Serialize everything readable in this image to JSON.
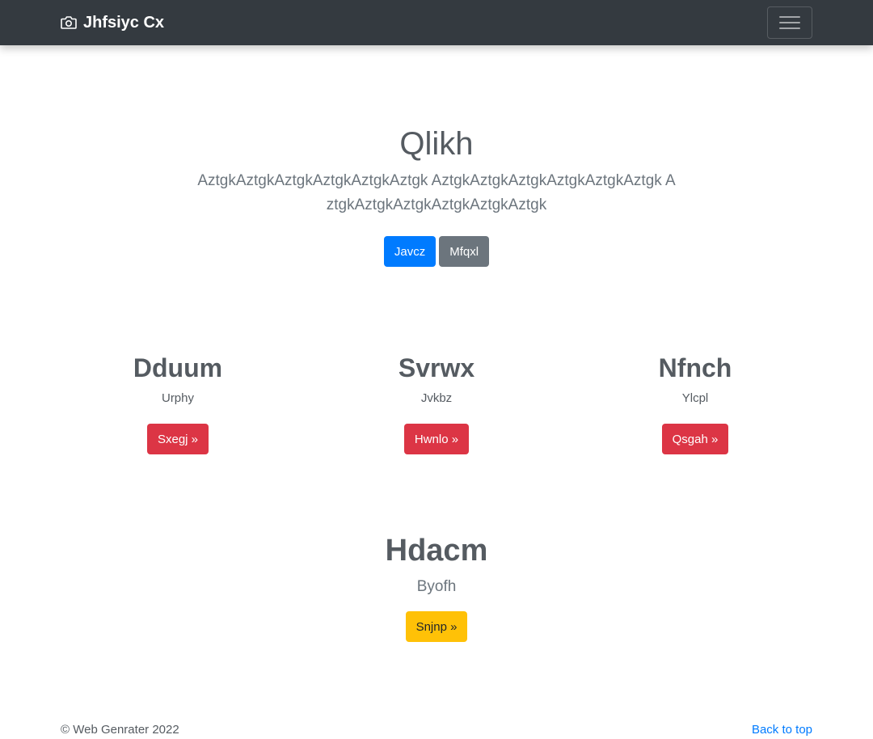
{
  "navbar": {
    "brand": "Jhfsiyc Cx",
    "brand_icon": "camera-icon",
    "toggler_icon": "hamburger-icon"
  },
  "hero": {
    "title": "Qlikh",
    "lead": "AztgkAztgkAztgkAztgkAztgkAztgk AztgkAztgkAztgkAztgkAztgkAztgk AztgkAztgkAztgkAztgkAztgkAztgk",
    "primary_button": "Javcz",
    "secondary_button": "Mfqxl"
  },
  "features": [
    {
      "title": "Dduum",
      "text": "Urphy",
      "button": "Sxegj »"
    },
    {
      "title": "Svrwx",
      "text": "Jvkbz",
      "button": "Hwnlo »"
    },
    {
      "title": "Nfnch",
      "text": "Ylcpl",
      "button": "Qsgah »"
    }
  ],
  "feature2": {
    "title": "Hdacm",
    "text": "Byofh",
    "button": "Snjnp »"
  },
  "footer": {
    "copyright": "© Web Genrater 2022",
    "back_to_top": "Back to top"
  },
  "colors": {
    "navbar_bg": "#343a40",
    "primary": "#007bff",
    "secondary": "#6c757d",
    "danger": "#dc3545",
    "warning": "#ffc107"
  }
}
